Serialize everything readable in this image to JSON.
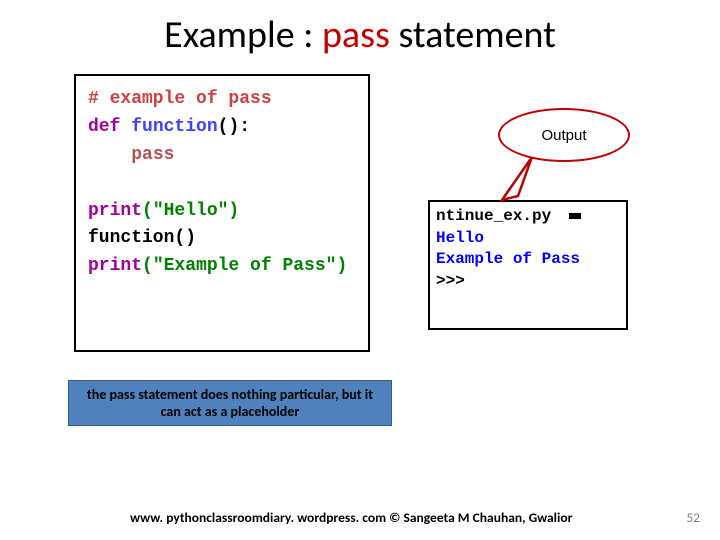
{
  "title": {
    "prefix": "Example : ",
    "highlight": "pass",
    "suffix": " statement"
  },
  "code": {
    "comment": "# example of pass",
    "def_kw": "def",
    "fname": "function",
    "parens": "():",
    "pass_kw": "pass",
    "print1_fn": "print",
    "print1_arg": "(\"Hello\")",
    "call_fn": "function",
    "call_parens": "()",
    "print2_fn": "print",
    "print2_arg": "(\"Example of Pass\")"
  },
  "callout": {
    "label": "Output"
  },
  "output": {
    "line1": "ntinue_ex.py",
    "line2": "Hello",
    "line3": "Example of Pass",
    "prompt": ">>>"
  },
  "note": {
    "text": "the pass statement does nothing particular, but it can act as a placeholder"
  },
  "footer": {
    "url": "www. pythonclassroomdiary. wordpress. com ©  Sangeeta M Chauhan, Gwalior",
    "page": "52"
  }
}
